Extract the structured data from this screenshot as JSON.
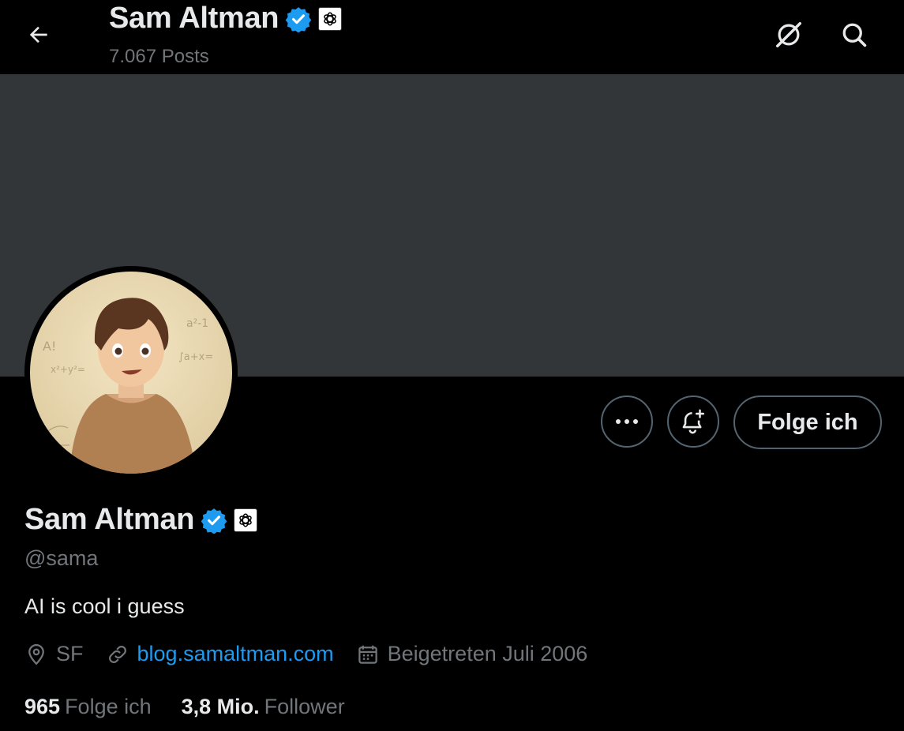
{
  "header": {
    "name": "Sam Altman",
    "posts": "7.067 Posts",
    "back_icon": "arrow-left-icon",
    "grok_icon": "grok-icon",
    "search_icon": "search-icon"
  },
  "profile": {
    "name": "Sam Altman",
    "handle": "@sama",
    "bio": "AI is cool i guess",
    "verified_color": "#1d9bf0",
    "location": "SF",
    "website": "blog.samaltman.com",
    "joined": "Beigetreten Juli 2006",
    "following_count": "965",
    "following_label": "Folge ich",
    "followers_count": "3,8 Mio.",
    "followers_label": "Follower"
  },
  "actions": {
    "more_icon": "more-dots-icon",
    "notify_icon": "bell-plus-icon",
    "follow_label": "Folge ich"
  },
  "colors": {
    "background": "#000000",
    "banner": "#333639",
    "accent": "#1d9bf0",
    "muted": "#71767b",
    "text": "#e7e9ea",
    "border": "#536471"
  }
}
